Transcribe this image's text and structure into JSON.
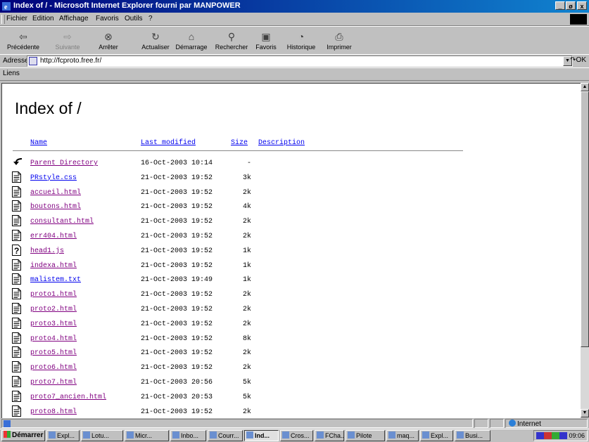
{
  "window": {
    "title": "Index of / - Microsoft Internet Explorer fourni par MANPOWER",
    "controls": [
      "_",
      "ø",
      "x"
    ]
  },
  "menu": [
    "Fichier",
    "Edition",
    "Affichage",
    "Favoris",
    "Outils",
    "?"
  ],
  "toolbar": [
    {
      "label": "Précédente",
      "icon": "back-arrow-icon",
      "enabled": true
    },
    {
      "label": "Suivante",
      "icon": "forward-arrow-icon",
      "enabled": false
    },
    {
      "label": "Arrêter",
      "icon": "stop-icon",
      "enabled": true
    },
    {
      "label": "Actualiser",
      "icon": "refresh-icon",
      "enabled": true
    },
    {
      "label": "Démarrage",
      "icon": "home-icon",
      "enabled": true
    },
    {
      "label": "Rechercher",
      "icon": "search-icon",
      "enabled": true
    },
    {
      "label": "Favoris",
      "icon": "favorites-icon",
      "enabled": true
    },
    {
      "label": "Historique",
      "icon": "history-icon",
      "enabled": true
    },
    {
      "label": "Imprimer",
      "icon": "print-icon",
      "enabled": true
    }
  ],
  "address": {
    "label": "Adresse",
    "url": "http://fcproto.free.fr/",
    "go_label": "OK"
  },
  "links": {
    "label": "Liens"
  },
  "page": {
    "heading": "Index of /",
    "columns": {
      "name": "Name",
      "modified": "Last modified",
      "size": "Size",
      "description": "Description"
    },
    "entries": [
      {
        "name": "Parent Directory",
        "modified": "16-Oct-2003 10:14",
        "size": "-",
        "icon": "back-folder-icon",
        "visited": true
      },
      {
        "name": "PRstyle.css",
        "modified": "21-Oct-2003 19:52",
        "size": "3k",
        "icon": "text-file-icon",
        "visited": false
      },
      {
        "name": "accueil.html",
        "modified": "21-Oct-2003 19:52",
        "size": "2k",
        "icon": "text-file-icon",
        "visited": true
      },
      {
        "name": "boutons.html",
        "modified": "21-Oct-2003 19:52",
        "size": "4k",
        "icon": "text-file-icon",
        "visited": true
      },
      {
        "name": "consultant.html",
        "modified": "21-Oct-2003 19:52",
        "size": "2k",
        "icon": "text-file-icon",
        "visited": true
      },
      {
        "name": "err404.html",
        "modified": "21-Oct-2003 19:52",
        "size": "2k",
        "icon": "text-file-icon",
        "visited": true
      },
      {
        "name": "head1.js",
        "modified": "21-Oct-2003 19:52",
        "size": "1k",
        "icon": "unknown-file-icon",
        "visited": true
      },
      {
        "name": "indexa.html",
        "modified": "21-Oct-2003 19:52",
        "size": "1k",
        "icon": "text-file-icon",
        "visited": true
      },
      {
        "name": "malistem.txt",
        "modified": "21-Oct-2003 19:49",
        "size": "1k",
        "icon": "text-file-icon",
        "visited": false
      },
      {
        "name": "proto1.html",
        "modified": "21-Oct-2003 19:52",
        "size": "2k",
        "icon": "text-file-icon",
        "visited": true
      },
      {
        "name": "proto2.html",
        "modified": "21-Oct-2003 19:52",
        "size": "2k",
        "icon": "text-file-icon",
        "visited": true
      },
      {
        "name": "proto3.html",
        "modified": "21-Oct-2003 19:52",
        "size": "2k",
        "icon": "text-file-icon",
        "visited": true
      },
      {
        "name": "proto4.html",
        "modified": "21-Oct-2003 19:52",
        "size": "8k",
        "icon": "text-file-icon",
        "visited": true
      },
      {
        "name": "proto5.html",
        "modified": "21-Oct-2003 19:52",
        "size": "2k",
        "icon": "text-file-icon",
        "visited": true
      },
      {
        "name": "proto6.html",
        "modified": "21-Oct-2003 19:52",
        "size": "2k",
        "icon": "text-file-icon",
        "visited": true
      },
      {
        "name": "proto7.html",
        "modified": "21-Oct-2003 20:56",
        "size": "5k",
        "icon": "text-file-icon",
        "visited": true
      },
      {
        "name": "proto7_ancien.html",
        "modified": "21-Oct-2003 20:53",
        "size": "5k",
        "icon": "text-file-icon",
        "visited": true
      },
      {
        "name": "proto8.html",
        "modified": "21-Oct-2003 19:52",
        "size": "2k",
        "icon": "text-file-icon",
        "visited": true
      }
    ]
  },
  "status": {
    "zone": "Internet"
  },
  "taskbar": {
    "start_label": "Démarrer",
    "tasks": [
      {
        "label": "Expl...",
        "active": false
      },
      {
        "label": "Lotu...",
        "active": false
      },
      {
        "label": "Micr...",
        "active": false
      },
      {
        "label": "Inbo...",
        "active": false
      },
      {
        "label": "Courr...",
        "active": false
      },
      {
        "label": "Ind...",
        "active": true
      },
      {
        "label": "Cros...",
        "active": false
      },
      {
        "label": "FCha...",
        "active": false
      },
      {
        "label": "Pilote",
        "active": false
      },
      {
        "label": "maq...",
        "active": false
      },
      {
        "label": "Expl...",
        "active": false
      },
      {
        "label": "Busi...",
        "active": false
      }
    ],
    "clock": "09:06"
  },
  "colors": {
    "titlebar_start": "#00007b",
    "titlebar_end": "#1084d0",
    "link": "#0000ee",
    "visited_link": "#800080",
    "chrome": "#c0c0c0"
  }
}
